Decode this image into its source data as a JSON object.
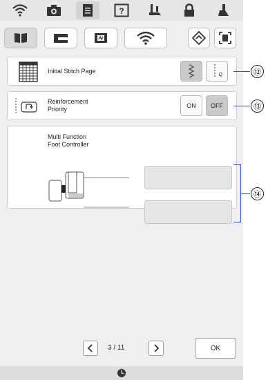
{
  "colors": {
    "callout": "#1f5fb8",
    "screen_bg": "#efefef",
    "selected_button": "#cacaca"
  },
  "tabbar": {
    "tabs": [
      {
        "icon": "wifi-icon",
        "active": false
      },
      {
        "icon": "camera-icon",
        "active": false
      },
      {
        "icon": "document-icon",
        "active": true
      },
      {
        "icon": "help-icon",
        "label": "?",
        "active": false
      },
      {
        "icon": "sewing-foot-icon",
        "active": false
      },
      {
        "icon": "lock-icon",
        "active": false
      },
      {
        "icon": "presser-foot-icon",
        "active": false
      }
    ]
  },
  "catbar": {
    "items": [
      {
        "icon": "sewing-settings-icon",
        "selected": true
      },
      {
        "icon": "machine-settings-icon",
        "selected": false
      },
      {
        "icon": "embroidery-settings-icon",
        "selected": false
      },
      {
        "icon": "wlan-icon",
        "selected": false
      },
      {
        "icon": "diamond-arrow-icon",
        "selected": false
      },
      {
        "icon": "screen-icon",
        "selected": false
      }
    ]
  },
  "settings": {
    "initial_stitch": {
      "label": "Initial Stitch Page",
      "options": [
        {
          "icon": "zigzag-stitch-icon",
          "selected": true
        },
        {
          "icon": "straight-stitch-q-icon",
          "label": "Q",
          "selected": false
        }
      ]
    },
    "reinforcement": {
      "label_line1": "Reinforcement",
      "label_line2": "Priority",
      "on_label": "ON",
      "off_label": "OFF",
      "selected": "OFF"
    },
    "foot_controller": {
      "label_line1": "Multi Function",
      "label_line2": "Foot Controller",
      "value1": "",
      "value2": ""
    }
  },
  "pager": {
    "current": "3",
    "separator": "/",
    "total": "11",
    "text": "3 / 11"
  },
  "ok_label": "OK",
  "callouts": {
    "c12": "⑫",
    "c13": "⑬",
    "c14": "⑭"
  }
}
